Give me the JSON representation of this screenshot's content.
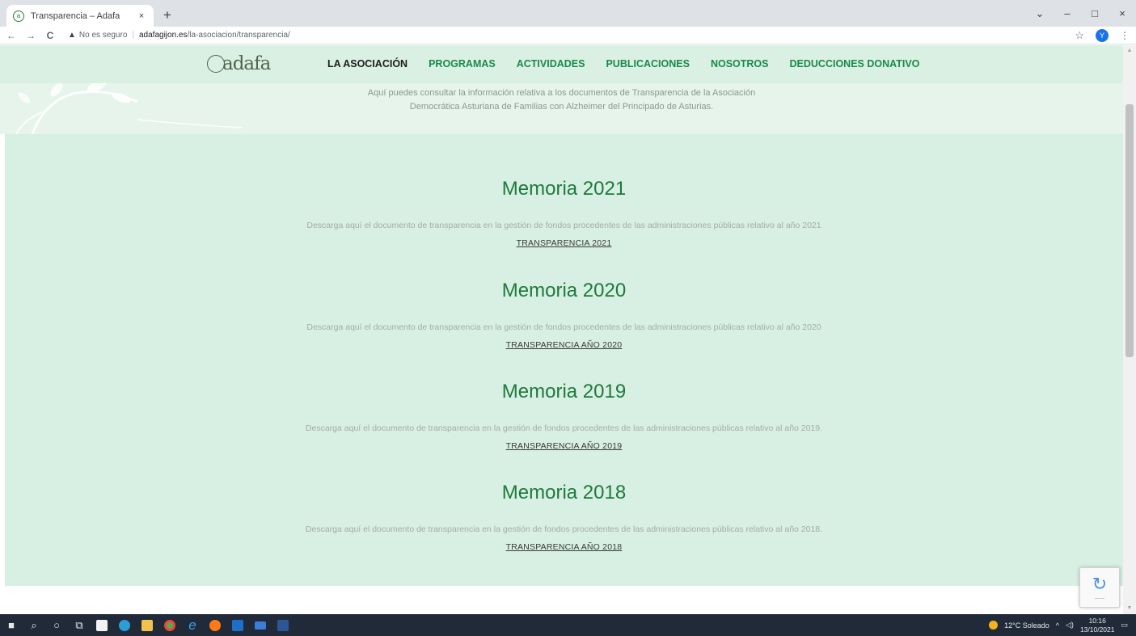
{
  "browser": {
    "tab_title": "Transparencia – Adafa",
    "tab_close": "×",
    "new_tab": "+",
    "back": "←",
    "forward": "→",
    "reload": "C",
    "security_text": "No es seguro",
    "url_host": "adafagijon.es",
    "url_path": "/la-asociacion/transparencia/",
    "profile_initial": "Y",
    "window_controls": [
      "⌄",
      "–",
      "□",
      "×"
    ]
  },
  "site": {
    "logo": "adafa",
    "nav": [
      "LA ASOCIACIÓN",
      "PROGRAMAS",
      "ACTIVIDADES",
      "PUBLICACIONES",
      "NOSOTROS",
      "DEDUCCIONES DONATIVO"
    ],
    "intro_line1": "Aquí puedes consultar la información relativa a los documentos de Transparencia de la Asociación",
    "intro_line2": "Democrática Asturiana de Familias con Alzheimer del Principado de Asturias."
  },
  "sections": [
    {
      "title": "Memoria 2021",
      "description": "Descarga aquí el documento de transparencia en la gestión de fondos procedentes de las administraciones públicas relativo al año 2021",
      "link": "TRANSPARENCIA 2021"
    },
    {
      "title": "Memoria 2020",
      "description": "Descarga aquí el documento de transparencia en la gestión de fondos procedentes de las administraciones públicas relativo al año 2020",
      "link": "TRANSPARENCIA AÑO 2020"
    },
    {
      "title": "Memoria 2019",
      "description": "Descarga aquí el documento de transparencia en la gestión de fondos procedentes de las administraciones públicas relativo al año 2019.",
      "link": "TRANSPARENCIA AÑO 2019"
    },
    {
      "title": "Memoria 2018",
      "description": "Descarga aquí el documento de transparencia en la gestión de fondos procedentes de las administraciones públicas relativo al año 2018.",
      "link": "TRANSPARENCIA AÑO 2018"
    }
  ],
  "taskbar": {
    "weather": "12°C Soleado",
    "time": "10:16",
    "date": "13/10/2021"
  },
  "colors": {
    "nav_green": "#1a8a4a",
    "title_green": "#1e7a3c",
    "content_bg": "#d8efe3",
    "header_bg": "#d9f0e2"
  }
}
